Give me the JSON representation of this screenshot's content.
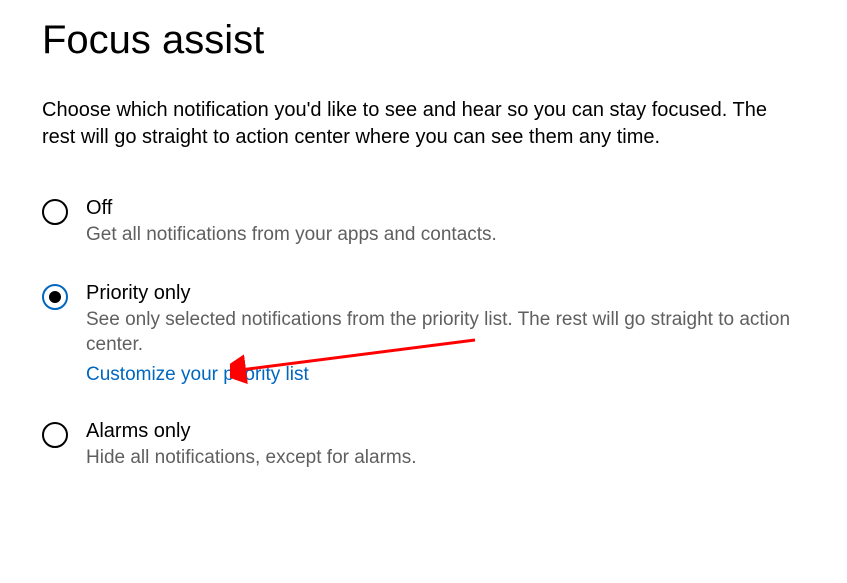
{
  "title": "Focus assist",
  "description": "Choose which notification you'd like to see and hear so you can stay focused. The rest will go straight to action center where you can see them any time.",
  "options": {
    "off": {
      "label": "Off",
      "desc": "Get all notifications from your apps and contacts."
    },
    "priority": {
      "label": "Priority only",
      "desc": "See only selected notifications from the priority list. The rest will go straight to action center.",
      "link": "Customize your priority list"
    },
    "alarms": {
      "label": "Alarms only",
      "desc": "Hide all notifications, except for alarms."
    }
  },
  "selected": "priority"
}
